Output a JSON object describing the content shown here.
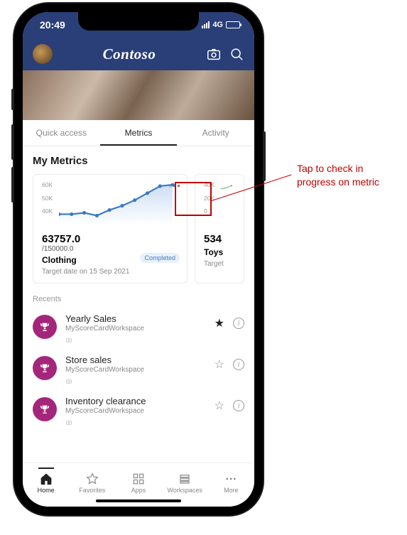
{
  "status": {
    "time": "20:49",
    "network": "4G"
  },
  "header": {
    "brand": "Contoso"
  },
  "tabs": {
    "quick": "Quick access",
    "metrics": "Metrics",
    "activity": "Activity",
    "active": "metrics"
  },
  "section_title": "My Metrics",
  "card_main": {
    "y_ticks": [
      "60K",
      "50K",
      "40K"
    ],
    "value": "63757.0",
    "target": "/150000.0",
    "name": "Clothing",
    "date_label": "Target date on 15 Sep 2021",
    "badge": "Completed"
  },
  "card_peek": {
    "y_ticks": [
      "40K",
      "20K",
      "0"
    ],
    "value": "534",
    "name": "Toys",
    "date_label": "Target"
  },
  "chart_data": {
    "type": "line",
    "title": "Clothing metric trend",
    "ylabel": "",
    "ylim": [
      36000,
      64000
    ],
    "x": [
      0,
      1,
      2,
      3,
      4,
      5,
      6,
      7,
      8,
      9
    ],
    "values": [
      40000,
      40000,
      41000,
      39500,
      43000,
      46000,
      50000,
      56000,
      62000,
      63757
    ]
  },
  "recents_label": "Recents",
  "recents": [
    {
      "title": "Yearly Sales",
      "subtitle": "MyScoreCardWorkspace",
      "starred": true
    },
    {
      "title": "Store sales",
      "subtitle": "MyScoreCardWorkspace",
      "starred": false
    },
    {
      "title": "Inventory clearance",
      "subtitle": "MyScoreCardWorkspace",
      "starred": false
    }
  ],
  "nav": {
    "home": "Home",
    "favorites": "Favorites",
    "apps": "Apps",
    "workspaces": "Workspaces",
    "more": "More",
    "active": "home"
  },
  "annotation": {
    "line1": "Tap to check in",
    "line2": "progress on metric"
  }
}
